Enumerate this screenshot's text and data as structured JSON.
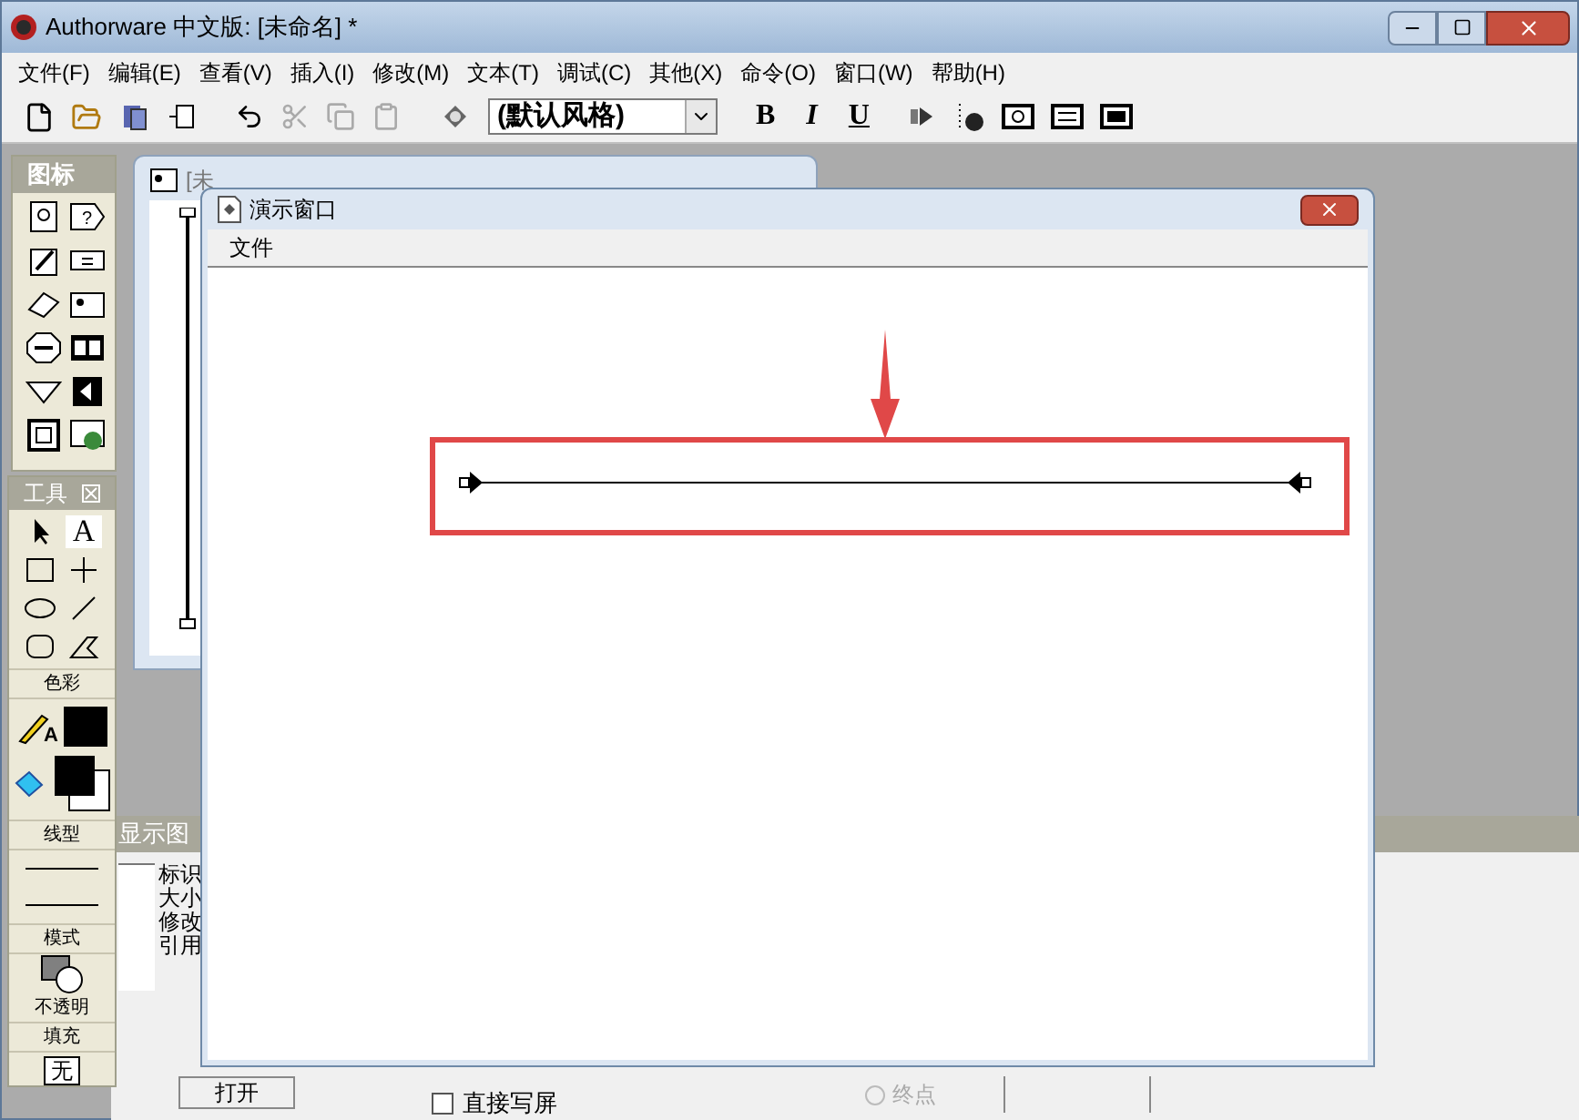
{
  "window": {
    "title": "Authorware 中文版: [未命名] *"
  },
  "menu": [
    "文件(F)",
    "编辑(E)",
    "查看(V)",
    "插入(I)",
    "修改(M)",
    "文本(T)",
    "调试(C)",
    "其他(X)",
    "命令(O)",
    "窗口(W)",
    "帮助(H)"
  ],
  "toolbar": {
    "style_select": "(默认风格)",
    "bold": "B",
    "italic": "I",
    "underline": "U"
  },
  "icon_palette": {
    "title": "图标",
    "question_mark": "?"
  },
  "tools_palette": {
    "title": "工具",
    "text_tool": "A",
    "pencil_letter": "A",
    "color_label": "色彩",
    "line_label": "线型",
    "mode_label": "模式",
    "mode_value": "不透明",
    "fill_label": "填充",
    "fill_value": "无"
  },
  "flowline_window": {
    "title": "[未"
  },
  "properties": {
    "title": "显示图",
    "labels": [
      "标识",
      "大小",
      "修改",
      "引用"
    ],
    "open_button": "打开",
    "direct_write": {
      "label": "直接写屏",
      "checked": false
    },
    "end_point": {
      "label": "终点",
      "disabled": true
    }
  },
  "demo_window": {
    "title": "演示窗口",
    "menu": [
      "文件"
    ]
  }
}
